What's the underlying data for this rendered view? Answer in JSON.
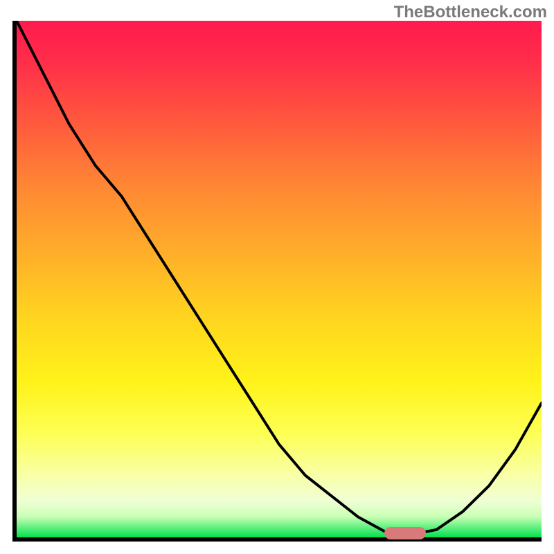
{
  "watermark": "TheBottleneck.com",
  "chart_data": {
    "type": "line",
    "title": "",
    "xlabel": "",
    "ylabel": "",
    "x": [
      0.0,
      0.05,
      0.1,
      0.15,
      0.2,
      0.25,
      0.3,
      0.35,
      0.4,
      0.45,
      0.5,
      0.55,
      0.6,
      0.65,
      0.7,
      0.725,
      0.75,
      0.8,
      0.85,
      0.9,
      0.95,
      1.0
    ],
    "y": [
      1.0,
      0.9,
      0.8,
      0.72,
      0.66,
      0.58,
      0.5,
      0.42,
      0.34,
      0.26,
      0.18,
      0.12,
      0.08,
      0.04,
      0.012,
      0.005,
      0.005,
      0.015,
      0.05,
      0.1,
      0.17,
      0.26
    ],
    "xlim": [
      0,
      1
    ],
    "ylim": [
      0,
      1
    ],
    "marker": {
      "x_start": 0.7,
      "x_end": 0.78,
      "y": 0.008,
      "color": "#d87a7a"
    },
    "gradient_colors": {
      "top": "#ff1a4d",
      "mid": "#fff31a",
      "bottom": "#00e24f"
    }
  }
}
